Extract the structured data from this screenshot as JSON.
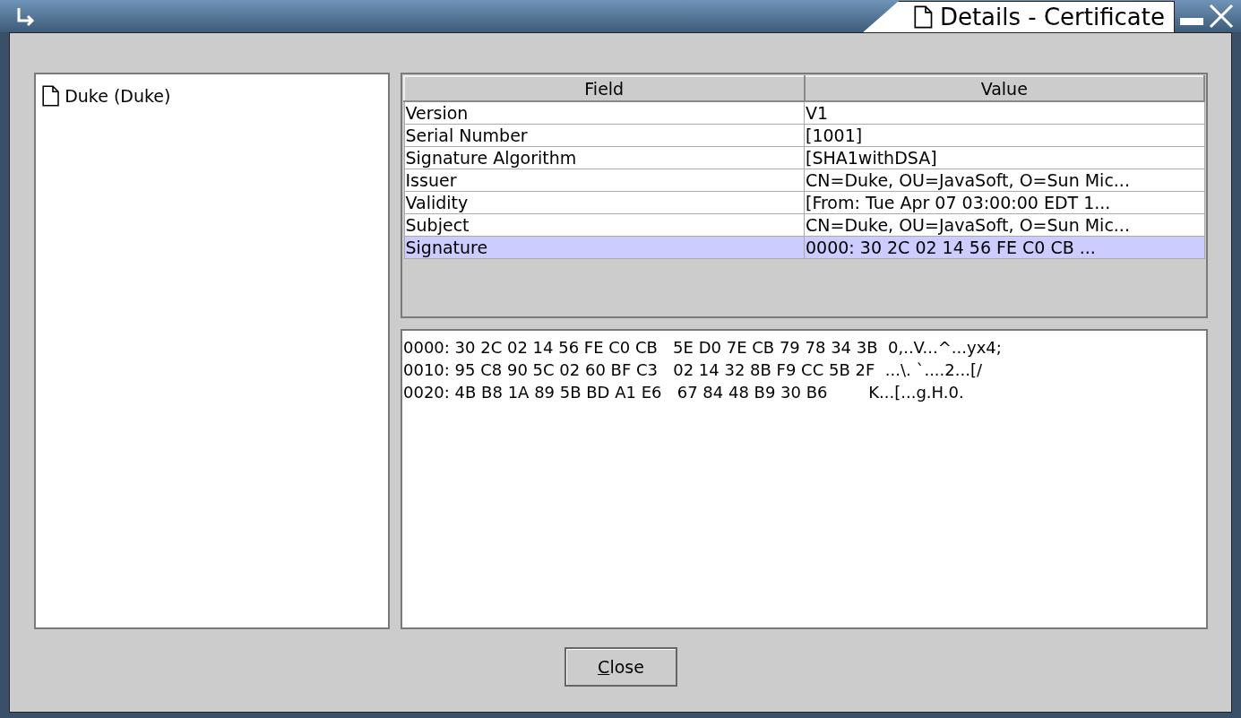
{
  "window": {
    "title": "Details - Certificate"
  },
  "tree": {
    "items": [
      {
        "label": "Duke (Duke)",
        "selected": false
      }
    ]
  },
  "table": {
    "columns": [
      "Field",
      "Value"
    ],
    "rows": [
      {
        "cells": [
          "Version",
          "V1"
        ],
        "selected": false
      },
      {
        "cells": [
          "Serial Number",
          "[1001]"
        ],
        "selected": false
      },
      {
        "cells": [
          "Signature Algorithm",
          "[SHA1withDSA]"
        ],
        "selected": false
      },
      {
        "cells": [
          "Issuer",
          "CN=Duke, OU=JavaSoft, O=Sun Mic..."
        ],
        "selected": false
      },
      {
        "cells": [
          "Validity",
          "[From: Tue Apr 07 03:00:00 EDT 1..."
        ],
        "selected": false
      },
      {
        "cells": [
          "Subject",
          "CN=Duke, OU=JavaSoft, O=Sun Mic..."
        ],
        "selected": false
      },
      {
        "cells": [
          "Signature",
          "0000: 30 2C 02 14 56 FE C0 CB   ..."
        ],
        "selected": true
      }
    ]
  },
  "detail": {
    "lines": [
      "0000: 30 2C 02 14 56 FE C0 CB   5E D0 7E CB 79 78 34 3B  0,..V...^...yx4;",
      "0010: 95 C8 90 5C 02 60 BF C3   02 14 32 8B F9 CC 5B 2F  ...\\. `....2...[/",
      "0020: 4B B8 1A 89 5B BD A1 E6   67 84 48 B9 30 B6        K...[...g.H.0."
    ]
  },
  "buttons": [
    {
      "label": "Close",
      "first_letter_underlined": true
    }
  ]
}
